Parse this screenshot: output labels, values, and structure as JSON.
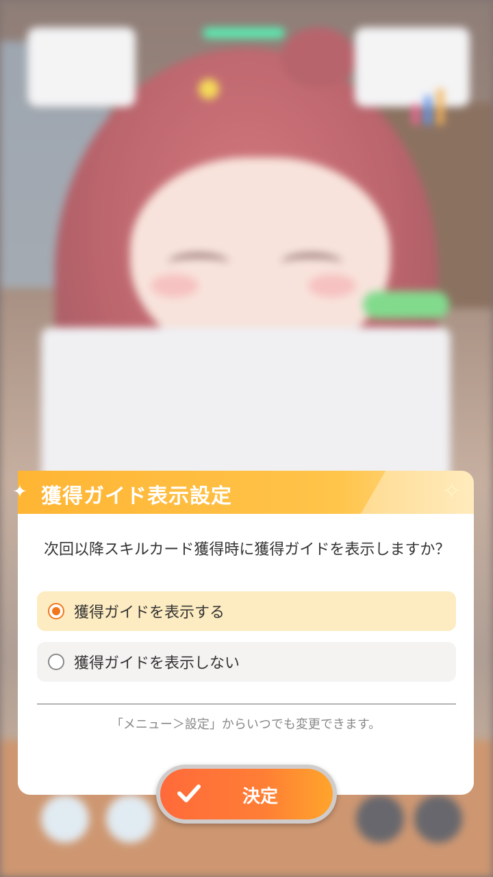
{
  "dialog": {
    "title": "獲得ガイド表示設定",
    "question": "次回以降スキルカード獲得時に獲得ガイドを表示しますか？",
    "options": [
      {
        "label": "獲得ガイドを表示する",
        "selected": true
      },
      {
        "label": "獲得ガイドを表示しない",
        "selected": false
      }
    ],
    "note": "「メニュー＞設定」からいつでも変更できます。",
    "confirm_label": "決定",
    "icons": {
      "header": "star-icon",
      "decoration": "sparkle-icon",
      "confirm": "check-icon"
    }
  },
  "colors": {
    "header": "#ffb534",
    "selected_option_bg": "#fdecc1",
    "radio_active": "#f2761b",
    "confirm_button": "#ff7e35"
  }
}
